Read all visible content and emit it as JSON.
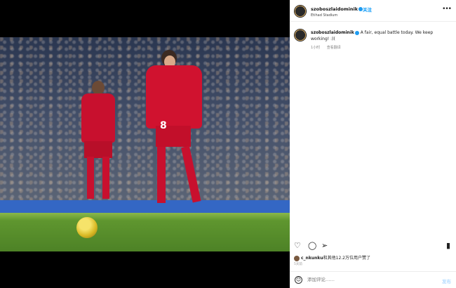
{
  "post": {
    "username": "szoboszlaidominik",
    "follow_label": "关注",
    "location": "Etihad Stadium",
    "caption": "A fair, equal battle today. We keep working! :)(",
    "time_ago": "1小时",
    "translate_label": "查看翻译",
    "more_icon": "•••",
    "photo_alt": "Liverpool players on the pitch",
    "player_number": "8",
    "likes": {
      "liked_by": "c_nkunku",
      "others_text": "和其他12.2万位用户",
      "suffix": "赞了"
    },
    "date_text": "5天前",
    "comment_placeholder": "添加评论……",
    "post_button": "发布"
  },
  "actions": {
    "like_icon": "♡",
    "comment_icon": "◯",
    "share_icon": "➢",
    "save_icon": "▮"
  },
  "colors": {
    "accent": "#0095f6",
    "kit_red": "#c8102e",
    "board_blue": "#3467c4"
  }
}
